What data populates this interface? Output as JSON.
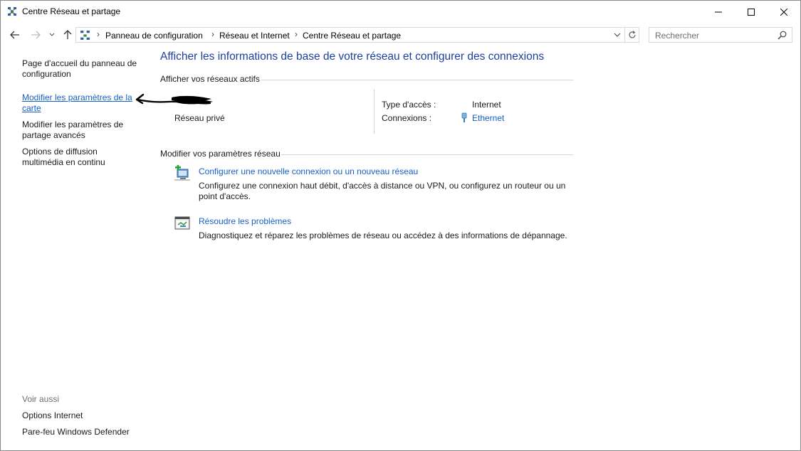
{
  "window": {
    "title": "Centre Réseau et partage"
  },
  "addressbar": {
    "breadcrumbs": [
      "Panneau de configuration",
      "Réseau et Internet",
      "Centre Réseau et partage"
    ],
    "search_placeholder": "Rechercher"
  },
  "sidebar": {
    "items": [
      {
        "label": "Page d'accueil du panneau de configuration"
      },
      {
        "label": "Modifier les paramètres de la carte"
      },
      {
        "label": "Modifier les paramètres de partage avancés"
      },
      {
        "label": "Options de diffusion multimédia en continu"
      }
    ],
    "see_also_title": "Voir aussi",
    "see_also": [
      {
        "label": "Options Internet"
      },
      {
        "label": "Pare-feu Windows Defender"
      }
    ]
  },
  "main": {
    "title": "Afficher les informations de base de votre réseau et configurer des connexions",
    "active_networks_heading": "Afficher vos réseaux actifs",
    "network": {
      "type": "Réseau privé",
      "access_type_label": "Type d'accès :",
      "access_type_value": "Internet",
      "connections_label": "Connexions :",
      "connections_value": "Ethernet"
    },
    "settings_heading": "Modifier vos paramètres réseau",
    "tasks": [
      {
        "title": "Configurer une nouvelle connexion ou un nouveau réseau",
        "description": "Configurez une connexion haut débit, d'accès à distance ou VPN, ou configurez un routeur ou un point d'accès."
      },
      {
        "title": "Résoudre les problèmes",
        "description": "Diagnostiquez et réparez les problèmes de réseau ou accédez à des informations de dépannage."
      }
    ]
  },
  "colors": {
    "link": "#1660c5",
    "title": "#1e3f9c",
    "divider": "#d5d5d5"
  },
  "icons": [
    "network-center-icon",
    "minimize-icon",
    "maximize-icon",
    "close-icon",
    "back-arrow-icon",
    "forward-arrow-icon",
    "chevron-down-icon",
    "up-arrow-icon",
    "refresh-icon",
    "search-icon",
    "ethernet-icon",
    "new-connection-icon",
    "troubleshoot-icon"
  ]
}
